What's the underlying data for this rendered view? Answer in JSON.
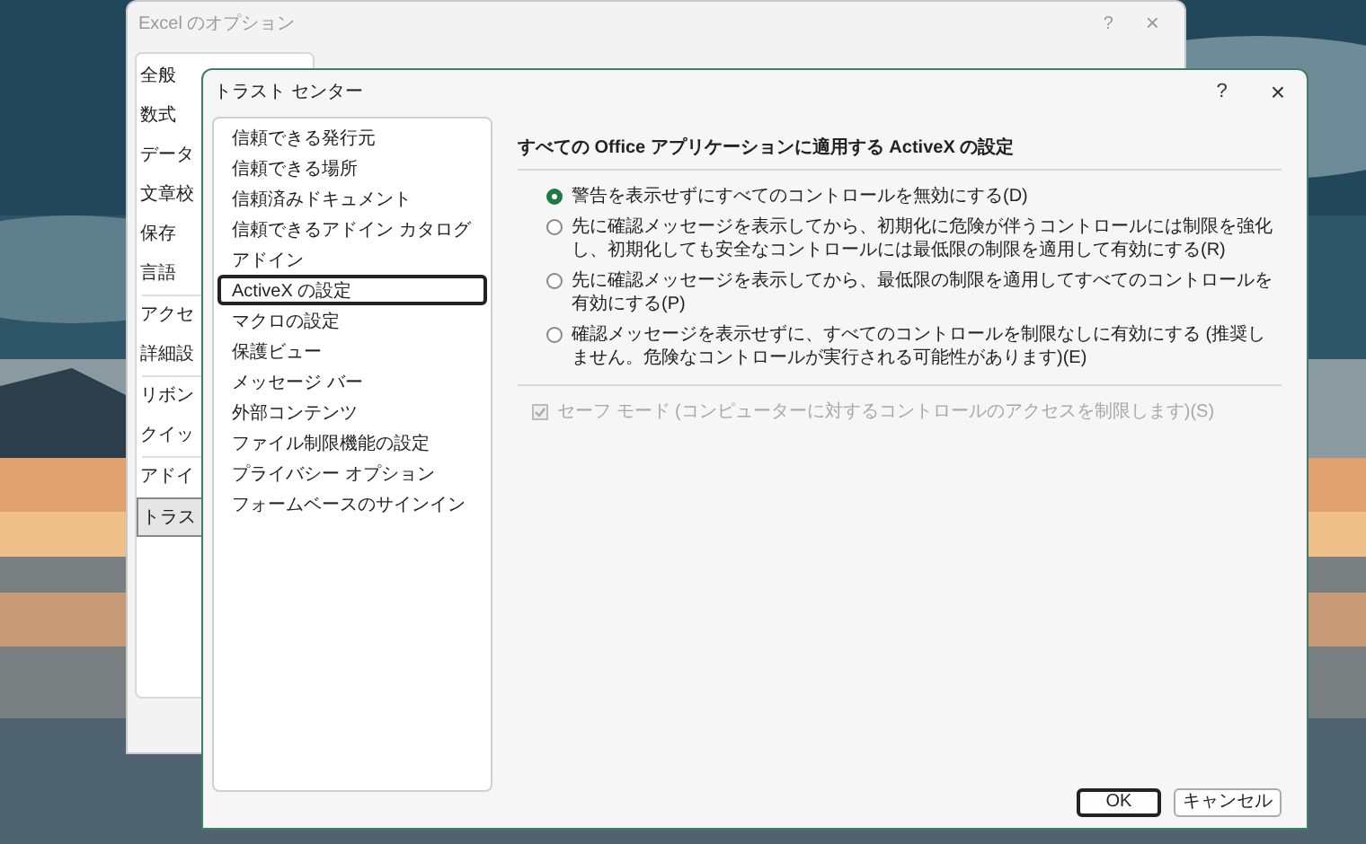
{
  "back_window": {
    "title": "Excel のオプション",
    "help": "?",
    "close": "×",
    "items": [
      {
        "label": "全般",
        "selected": false
      },
      {
        "label": "数式",
        "selected": false
      },
      {
        "label": "データ",
        "selected": false
      },
      {
        "label": "文章校",
        "selected": false
      },
      {
        "label": "保存",
        "selected": false
      },
      {
        "label": "言語",
        "selected": false
      },
      {
        "label": "アクセ",
        "selected": false
      },
      {
        "label": "詳細設",
        "selected": false
      },
      {
        "label": "リボン",
        "selected": false
      },
      {
        "label": "クイッ",
        "selected": false
      },
      {
        "label": "アドイ",
        "selected": false
      },
      {
        "label": "トラス",
        "selected": true
      }
    ]
  },
  "dialog": {
    "title": "トラスト センター",
    "help": "?",
    "close": "×",
    "nav": [
      {
        "label": "信頼できる発行元",
        "selected": false
      },
      {
        "label": "信頼できる場所",
        "selected": false
      },
      {
        "label": "信頼済みドキュメント",
        "selected": false
      },
      {
        "label": "信頼できるアドイン カタログ",
        "selected": false
      },
      {
        "label": "アドイン",
        "selected": false
      },
      {
        "label": "ActiveX の設定",
        "selected": true
      },
      {
        "label": "マクロの設定",
        "selected": false
      },
      {
        "label": "保護ビュー",
        "selected": false
      },
      {
        "label": "メッセージ バー",
        "selected": false
      },
      {
        "label": "外部コンテンツ",
        "selected": false
      },
      {
        "label": "ファイル制限機能の設定",
        "selected": false
      },
      {
        "label": "プライバシー オプション",
        "selected": false
      },
      {
        "label": "フォームベースのサインイン",
        "selected": false
      }
    ],
    "heading": "すべての Office アプリケーションに適用する ActiveX の設定",
    "options": [
      {
        "label": "警告を表示せずにすべてのコントロールを無効にする(D)",
        "selected": true
      },
      {
        "label": "先に確認メッセージを表示してから、初期化に危険が伴うコントロールには制限を強化し、初期化しても安全なコントロールには最低限の制限を適用して有効にする(R)",
        "selected": false
      },
      {
        "label": "先に確認メッセージを表示してから、最低限の制限を適用してすべてのコントロールを有効にする(P)",
        "selected": false
      },
      {
        "label": "確認メッセージを表示せずに、すべてのコントロールを制限なしに有効にする (推奨しません。危険なコントロールが実行される可能性があります)(E)",
        "selected": false
      }
    ],
    "safe_mode": {
      "label": "セーフ モード (コンピューターに対するコントロールのアクセスを制限します)(S)",
      "checked": true,
      "disabled": true
    },
    "buttons": [
      {
        "label": "OK",
        "default": true
      },
      {
        "label": "キャンセル",
        "default": false
      }
    ]
  }
}
